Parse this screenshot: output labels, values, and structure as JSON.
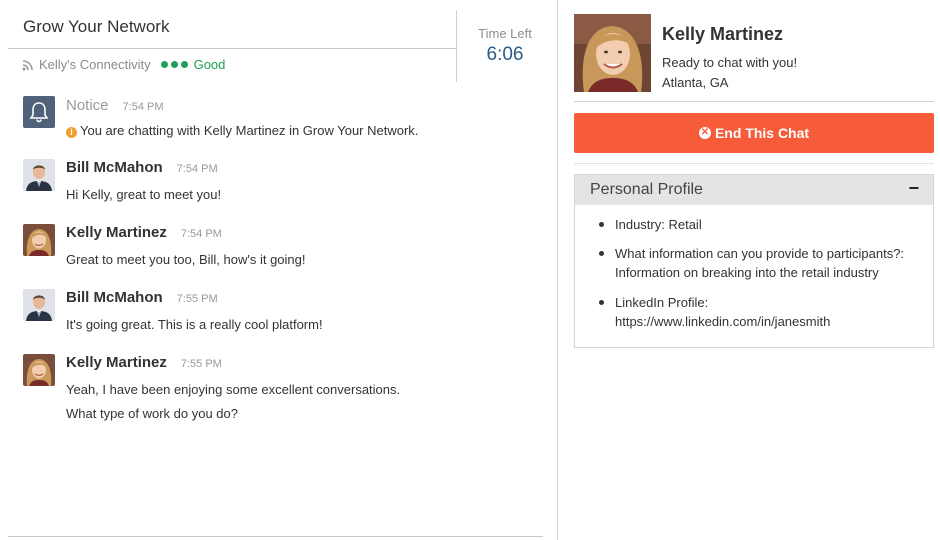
{
  "chat": {
    "title": "Grow Your Network",
    "connectivity_label": "Kelly's Connectivity",
    "connectivity_status": "Good",
    "time_left_label": "Time Left",
    "time_left_value": "6:06"
  },
  "messages": [
    {
      "name": "Notice",
      "time": "7:54 PM",
      "text": "You are chatting with Kelly Martinez in Grow Your Network.",
      "type": "notice"
    },
    {
      "name": "Bill McMahon",
      "time": "7:54 PM",
      "text": "Hi Kelly, great to meet you!",
      "type": "bill"
    },
    {
      "name": "Kelly Martinez",
      "time": "7:54 PM",
      "text": "Great to meet you too, Bill, how's it going!",
      "type": "kelly"
    },
    {
      "name": "Bill McMahon",
      "time": "7:55 PM",
      "text": "It's going great. This is a really cool platform!",
      "type": "bill"
    },
    {
      "name": "Kelly Martinez",
      "time": "7:55 PM",
      "text_line1": "Yeah, I have been enjoying some excellent conversations.",
      "text_line2": "What type of work do you do?",
      "type": "kelly"
    }
  ],
  "profile": {
    "name": "Kelly Martinez",
    "status": "Ready to chat with you!",
    "location": "Atlanta, GA",
    "end_chat_label": "End This Chat",
    "personal_profile_title": "Personal Profile",
    "collapse_symbol": "−",
    "items": [
      {
        "line1": "Industry: Retail"
      },
      {
        "line1": "What information can you provide to participants?:",
        "line2": "Information on breaking into the retail industry"
      },
      {
        "line1": "LinkedIn Profile:",
        "line2": "https://www.linkedin.com/in/janesmith"
      }
    ]
  },
  "colors": {
    "accent_end_chat": "#f65c3a",
    "status_good": "#1f9e57",
    "timer_value": "#2b5a86",
    "notice_icon_bg": "#50617a"
  },
  "icons": {
    "connectivity": "wifi-icon",
    "notice": "bell-icon",
    "info": "info-icon",
    "end_chat": "close-circle-icon",
    "collapse": "minus-icon"
  }
}
